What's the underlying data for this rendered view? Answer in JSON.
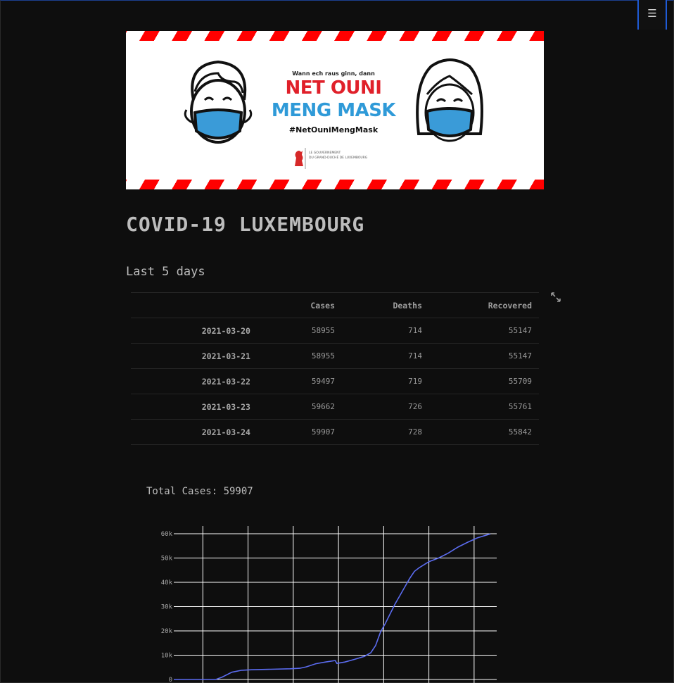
{
  "app": {
    "menu_icon": "hamburger-menu-icon",
    "menu_glyph": "☰"
  },
  "banner": {
    "small_text": "Wann ech raus ginn, dann",
    "line1": "NET OUNI",
    "line2": "MENG MASK",
    "hashtag": "#NetOuniMengMask",
    "gov_line1": "LE GOUVERNEMENT",
    "gov_line2": "DU GRAND-DUCHÉ DE LUXEMBOURG",
    "colors": {
      "red": "#ff0000",
      "blue": "#2f9ad8"
    }
  },
  "page": {
    "title": "COVID-19 LUXEMBOURG",
    "subtitle": "Last 5 days",
    "expand_icon": "fullscreen-expand-icon"
  },
  "table": {
    "columns": [
      "",
      "Cases",
      "Deaths",
      "Recovered"
    ],
    "rows": [
      [
        "2021-03-20",
        "58955",
        "714",
        "55147"
      ],
      [
        "2021-03-21",
        "58955",
        "714",
        "55147"
      ],
      [
        "2021-03-22",
        "59497",
        "719",
        "55709"
      ],
      [
        "2021-03-23",
        "59662",
        "726",
        "55761"
      ],
      [
        "2021-03-24",
        "59907",
        "728",
        "55842"
      ]
    ]
  },
  "total": {
    "label": "Total Cases: 59907"
  },
  "chart_data": {
    "type": "line",
    "title": "",
    "xlabel": "",
    "ylabel": "",
    "y_tick_labels": [
      "0",
      "10k",
      "20k",
      "30k",
      "40k",
      "50k",
      "60k"
    ],
    "y_ticks": [
      0,
      10000,
      20000,
      30000,
      40000,
      50000,
      60000
    ],
    "ylim": [
      0,
      60000
    ],
    "xlim": [
      0,
      100
    ],
    "x_gridlines": [
      9,
      23,
      37,
      51,
      65,
      79,
      93
    ],
    "grid": true,
    "line_color": "#5b6cf0",
    "series": [
      {
        "values": [
          [
            0,
            0
          ],
          [
            13,
            0
          ],
          [
            15,
            1000
          ],
          [
            18,
            3000
          ],
          [
            21,
            3800
          ],
          [
            24,
            4000
          ],
          [
            30,
            4200
          ],
          [
            36,
            4400
          ],
          [
            39,
            4600
          ],
          [
            41,
            5200
          ],
          [
            44,
            6500
          ],
          [
            47,
            7200
          ],
          [
            50,
            7800
          ],
          [
            50.5,
            6600
          ],
          [
            53,
            7200
          ],
          [
            56,
            8300
          ],
          [
            59,
            9500
          ],
          [
            61,
            11000
          ],
          [
            62.5,
            14000
          ],
          [
            64,
            19500
          ],
          [
            65.5,
            23000
          ],
          [
            67,
            27000
          ],
          [
            68.5,
            31000
          ],
          [
            70,
            34500
          ],
          [
            71.5,
            38000
          ],
          [
            73,
            41500
          ],
          [
            74.5,
            44500
          ],
          [
            76,
            46000
          ],
          [
            79,
            48500
          ],
          [
            82,
            50000
          ],
          [
            85,
            52000
          ],
          [
            88,
            54500
          ],
          [
            91,
            56500
          ],
          [
            94,
            58300
          ],
          [
            98,
            59907
          ]
        ]
      }
    ]
  }
}
